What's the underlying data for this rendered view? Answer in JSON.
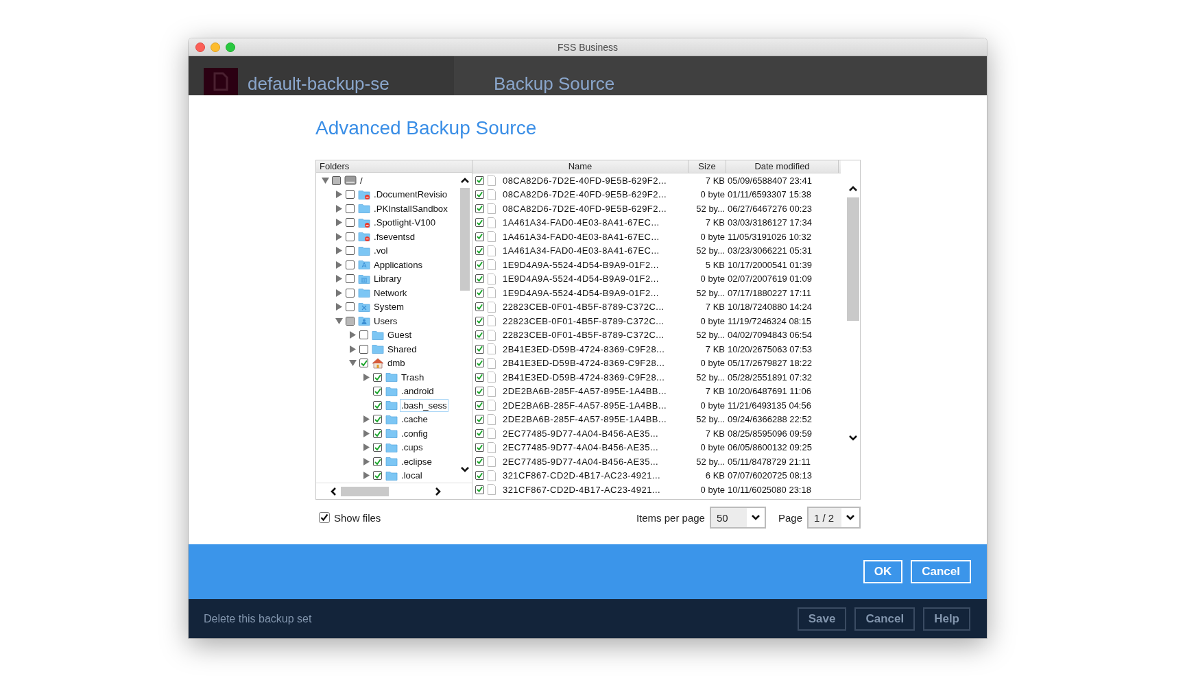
{
  "window": {
    "title": "FSS Business"
  },
  "header": {
    "backup_set": "default-backup-se",
    "section": "Backup Source"
  },
  "dialog": {
    "title": "Advanced Backup Source",
    "folders_heading": "Folders",
    "folders": [
      {
        "label": "/",
        "kind": "drive",
        "checked": false,
        "partial": true,
        "expandable": true,
        "expanded": true,
        "selected": false,
        "children": [
          {
            "label": ".DocumentRevisio",
            "kind": "restricted",
            "checked": false,
            "partial": false,
            "expandable": true,
            "expanded": false,
            "selected": false
          },
          {
            "label": ".PKInstallSandbox",
            "kind": "folder",
            "checked": false,
            "partial": false,
            "expandable": true,
            "expanded": false,
            "selected": false
          },
          {
            "label": ".Spotlight-V100",
            "kind": "restricted",
            "checked": false,
            "partial": false,
            "expandable": true,
            "expanded": false,
            "selected": false
          },
          {
            "label": ".fseventsd",
            "kind": "restricted",
            "checked": false,
            "partial": false,
            "expandable": true,
            "expanded": false,
            "selected": false
          },
          {
            "label": ".vol",
            "kind": "folder",
            "checked": false,
            "partial": false,
            "expandable": true,
            "expanded": false,
            "selected": false
          },
          {
            "label": "Applications",
            "kind": "applications",
            "checked": false,
            "partial": false,
            "expandable": true,
            "expanded": false,
            "selected": false
          },
          {
            "label": "Library",
            "kind": "library",
            "checked": false,
            "partial": false,
            "expandable": true,
            "expanded": false,
            "selected": false
          },
          {
            "label": "Network",
            "kind": "folder",
            "checked": false,
            "partial": false,
            "expandable": true,
            "expanded": false,
            "selected": false
          },
          {
            "label": "System",
            "kind": "system",
            "checked": false,
            "partial": false,
            "expandable": true,
            "expanded": false,
            "selected": false
          },
          {
            "label": "Users",
            "kind": "users",
            "checked": false,
            "partial": true,
            "expandable": true,
            "expanded": true,
            "selected": false,
            "children": [
              {
                "label": "Guest",
                "kind": "folder",
                "checked": false,
                "partial": false,
                "expandable": true,
                "expanded": false,
                "selected": false
              },
              {
                "label": "Shared",
                "kind": "folder",
                "checked": false,
                "partial": false,
                "expandable": true,
                "expanded": false,
                "selected": false
              },
              {
                "label": "dmb",
                "kind": "home",
                "checked": true,
                "partial": false,
                "expandable": true,
                "expanded": true,
                "selected": false,
                "children": [
                  {
                    "label": "Trash",
                    "kind": "folder",
                    "checked": true,
                    "partial": false,
                    "expandable": true,
                    "expanded": false,
                    "selected": false
                  },
                  {
                    "label": ".android",
                    "kind": "folder",
                    "checked": true,
                    "partial": false,
                    "expandable": false,
                    "selected": false
                  },
                  {
                    "label": ".bash_sess",
                    "kind": "folder",
                    "checked": true,
                    "partial": false,
                    "expandable": false,
                    "selected": true
                  },
                  {
                    "label": ".cache",
                    "kind": "folder",
                    "checked": true,
                    "partial": false,
                    "expandable": true,
                    "expanded": false,
                    "selected": false
                  },
                  {
                    "label": ".config",
                    "kind": "folder",
                    "checked": true,
                    "partial": false,
                    "expandable": true,
                    "expanded": false,
                    "selected": false
                  },
                  {
                    "label": ".cups",
                    "kind": "folder",
                    "checked": true,
                    "partial": false,
                    "expandable": true,
                    "expanded": false,
                    "selected": false
                  },
                  {
                    "label": ".eclipse",
                    "kind": "folder",
                    "checked": true,
                    "partial": false,
                    "expandable": true,
                    "expanded": false,
                    "selected": false
                  },
                  {
                    "label": ".local",
                    "kind": "folder",
                    "checked": true,
                    "partial": false,
                    "expandable": true,
                    "expanded": false,
                    "selected": false
                  }
                ]
              }
            ]
          }
        ]
      }
    ],
    "file_columns": [
      "Name",
      "Size",
      "Date modified"
    ],
    "files": [
      {
        "checked": true,
        "name": "08CA82D6-7D2E-40FD-9E5B-629F2...",
        "size": "7 KB",
        "date": "05/09/6588407 23:41"
      },
      {
        "checked": true,
        "name": "08CA82D6-7D2E-40FD-9E5B-629F2...",
        "size": "0 byte",
        "date": "01/11/6593307 15:38"
      },
      {
        "checked": true,
        "name": "08CA82D6-7D2E-40FD-9E5B-629F2...",
        "size": "52 by...",
        "date": "06/27/6467276 00:23"
      },
      {
        "checked": true,
        "name": "1A461A34-FAD0-4E03-8A41-67EC...",
        "size": "7 KB",
        "date": "03/03/3186127 17:34"
      },
      {
        "checked": true,
        "name": "1A461A34-FAD0-4E03-8A41-67EC...",
        "size": "0 byte",
        "date": "11/05/3191026 10:32"
      },
      {
        "checked": true,
        "name": "1A461A34-FAD0-4E03-8A41-67EC...",
        "size": "52 by...",
        "date": "03/23/3066221 05:31"
      },
      {
        "checked": true,
        "name": "1E9D4A9A-5524-4D54-B9A9-01F2...",
        "size": "5 KB",
        "date": "10/17/2000541 01:39"
      },
      {
        "checked": true,
        "name": "1E9D4A9A-5524-4D54-B9A9-01F2...",
        "size": "0 byte",
        "date": "02/07/2007619 01:09"
      },
      {
        "checked": true,
        "name": "1E9D4A9A-5524-4D54-B9A9-01F2...",
        "size": "52 by...",
        "date": "07/17/1880227 17:11"
      },
      {
        "checked": true,
        "name": "22823CEB-0F01-4B5F-8789-C372C...",
        "size": "7 KB",
        "date": "10/18/7240880 14:24"
      },
      {
        "checked": true,
        "name": "22823CEB-0F01-4B5F-8789-C372C...",
        "size": "0 byte",
        "date": "11/19/7246324 08:15"
      },
      {
        "checked": true,
        "name": "22823CEB-0F01-4B5F-8789-C372C...",
        "size": "52 by...",
        "date": "04/02/7094843 06:54"
      },
      {
        "checked": true,
        "name": "2B41E3ED-D59B-4724-8369-C9F28...",
        "size": "7 KB",
        "date": "10/20/2675063 07:53"
      },
      {
        "checked": true,
        "name": "2B41E3ED-D59B-4724-8369-C9F28...",
        "size": "0 byte",
        "date": "05/17/2679827 18:22"
      },
      {
        "checked": true,
        "name": "2B41E3ED-D59B-4724-8369-C9F28...",
        "size": "52 by...",
        "date": "05/28/2551891 07:32"
      },
      {
        "checked": true,
        "name": "2DE2BA6B-285F-4A57-895E-1A4BB...",
        "size": "7 KB",
        "date": "10/20/6487691 11:06"
      },
      {
        "checked": true,
        "name": "2DE2BA6B-285F-4A57-895E-1A4BB...",
        "size": "0 byte",
        "date": "11/21/6493135 04:56"
      },
      {
        "checked": true,
        "name": "2DE2BA6B-285F-4A57-895E-1A4BB...",
        "size": "52 by...",
        "date": "09/24/6366288 22:52"
      },
      {
        "checked": true,
        "name": "2EC77485-9D77-4A04-B456-AE35...",
        "size": "7 KB",
        "date": "08/25/8595096 09:59"
      },
      {
        "checked": true,
        "name": "2EC77485-9D77-4A04-B456-AE35...",
        "size": "0 byte",
        "date": "06/05/8600132 09:25"
      },
      {
        "checked": true,
        "name": "2EC77485-9D77-4A04-B456-AE35...",
        "size": "52 by...",
        "date": "05/11/8478729 21:11"
      },
      {
        "checked": true,
        "name": "321CF867-CD2D-4B17-AC23-4921...",
        "size": "6 KB",
        "date": "07/07/6020725 08:13"
      },
      {
        "checked": true,
        "name": "321CF867-CD2D-4B17-AC23-4921...",
        "size": "0 byte",
        "date": "10/11/6025080 23:18"
      }
    ],
    "show_files": {
      "label": "Show files",
      "checked": true
    },
    "items_per_page": {
      "label": "Items per page",
      "value": "50"
    },
    "page": {
      "label": "Page",
      "value": "1 / 2"
    },
    "buttons": [
      "OK",
      "Cancel"
    ]
  },
  "footer": {
    "link": "Delete this backup set",
    "buttons": [
      "Save",
      "Cancel",
      "Help"
    ]
  }
}
